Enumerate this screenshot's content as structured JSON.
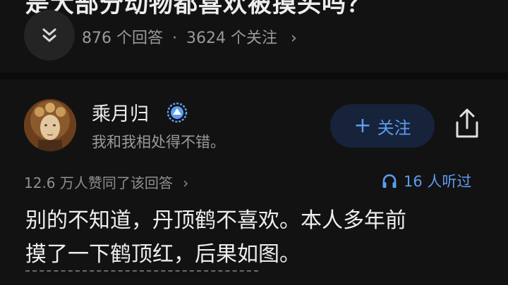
{
  "question": {
    "title": "是大部分动物都喜欢被摸头吗？",
    "answers_count": "876 个回答",
    "separator": "·",
    "followers_count": "3624 个关注",
    "chevron": "›"
  },
  "author": {
    "name": "乘月归",
    "bio": "我和我相处得不错。",
    "avatar_icon": "portrait-avatar",
    "badge_icon": "verified-badge-icon"
  },
  "actions": {
    "follow_plus": "+",
    "follow_label": "关注",
    "share_icon": "share-icon"
  },
  "meta": {
    "agree_text": "12.6 万人赞同了该回答",
    "agree_chevron": "›",
    "listen_text": "16 人听过",
    "listen_icon": "headphones-icon"
  },
  "answer": {
    "lines": [
      "别的不知道，丹顶鹤不喜欢。本人多年前",
      "摸了一下鹤顶红，后果如图。"
    ]
  },
  "colors": {
    "background": "#121212",
    "accent_blue": "#5d9cf0",
    "follow_bg": "#17233a"
  }
}
